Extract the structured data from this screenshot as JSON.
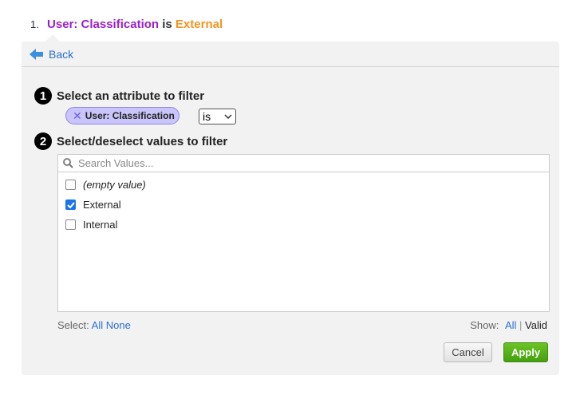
{
  "filter_summary": {
    "index": "1.",
    "attribute": "User: Classification",
    "operator": "is",
    "value": "External"
  },
  "header": {
    "back_label": "Back",
    "back_icon": "arrow-left-icon"
  },
  "step1": {
    "number": "1",
    "title": "Select an attribute to filter",
    "chip_label": "User: Classification",
    "operator_value": "is"
  },
  "step2": {
    "number": "2",
    "title": "Select/deselect values to filter",
    "search_placeholder": "Search Values...",
    "values": [
      {
        "label": "(empty value)",
        "checked": false,
        "italic": true
      },
      {
        "label": "External",
        "checked": true
      },
      {
        "label": "Internal",
        "checked": false
      }
    ]
  },
  "footer": {
    "select_label": "Select:",
    "all": "All",
    "none": "None",
    "show_label": "Show:",
    "show_all": "All",
    "separator": "|",
    "show_valid": "Valid"
  },
  "buttons": {
    "cancel": "Cancel",
    "apply": "Apply"
  },
  "colors": {
    "attribute": "#9b1fc8",
    "value": "#f7931e",
    "apply": "#4fa814",
    "link": "#2a6fd1"
  }
}
